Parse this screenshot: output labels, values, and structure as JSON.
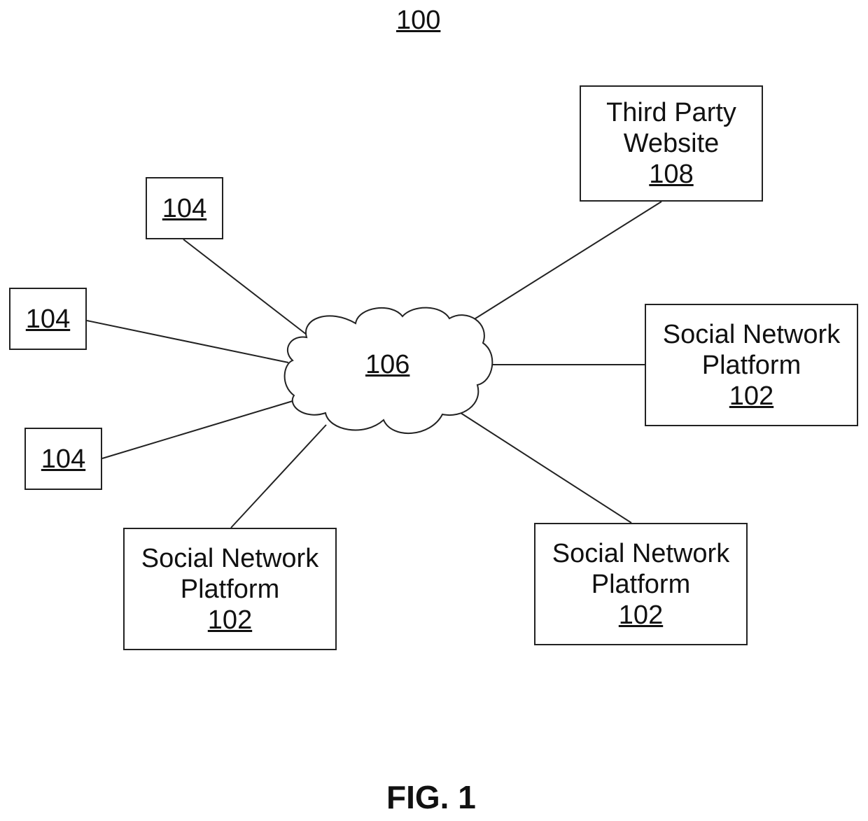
{
  "figure": {
    "ref": "100",
    "caption": "FIG. 1"
  },
  "network": {
    "label": "106"
  },
  "third_party": {
    "line1": "Third Party",
    "line2": "Website",
    "ref": "108"
  },
  "devices": [
    {
      "ref": "104"
    },
    {
      "ref": "104"
    },
    {
      "ref": "104"
    }
  ],
  "platforms": [
    {
      "line1": "Social Network",
      "line2": "Platform",
      "ref": "102"
    },
    {
      "line1": "Social Network",
      "line2": "Platform",
      "ref": "102"
    },
    {
      "line1": "Social Network",
      "line2": "Platform",
      "ref": "102"
    }
  ]
}
